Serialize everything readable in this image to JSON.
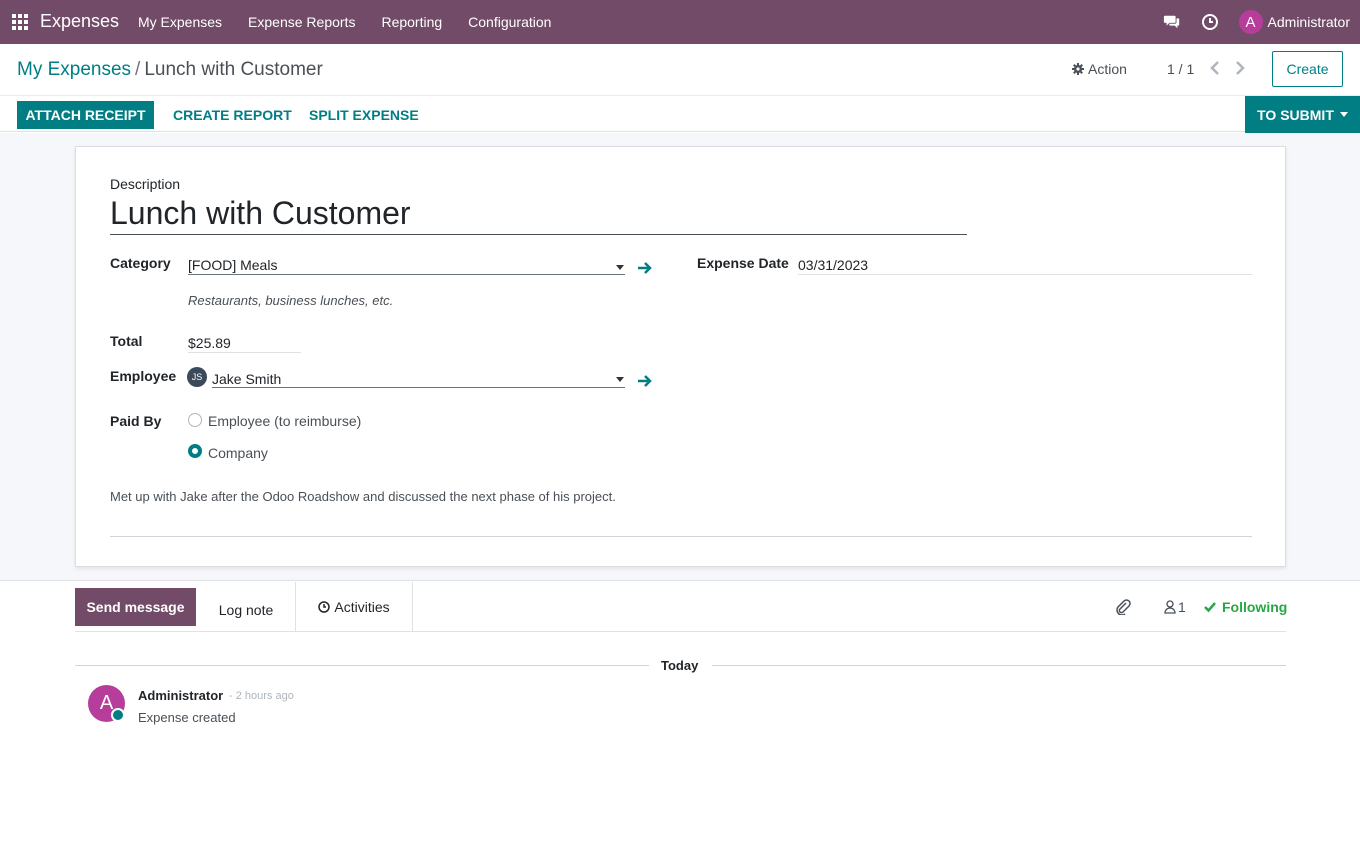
{
  "navbar": {
    "brand": "Expenses",
    "menu": [
      "My Expenses",
      "Expense Reports",
      "Reporting",
      "Configuration"
    ],
    "user_initial": "A",
    "user_name": "Administrator",
    "bg_color": "#714B67"
  },
  "breadcrumb": {
    "parent": "My Expenses",
    "separator": "/",
    "current": "Lunch with Customer"
  },
  "control": {
    "action_label": "Action",
    "pager": "1 / 1",
    "create_label": "Create"
  },
  "buttons": {
    "attach_receipt": "ATTACH RECEIPT",
    "create_report": "CREATE REPORT",
    "split_expense": "SPLIT EXPENSE",
    "status": "TO SUBMIT"
  },
  "form": {
    "description_label": "Description",
    "description": "Lunch with Customer",
    "category_label": "Category",
    "category": "[FOOD] Meals",
    "category_help": "Restaurants, business lunches, etc.",
    "expense_date_label": "Expense Date",
    "expense_date": "03/31/2023",
    "total_label": "Total",
    "total": "$25.89",
    "employee_label": "Employee",
    "employee_initials": "JS",
    "employee": "Jake Smith",
    "paid_by_label": "Paid By",
    "paid_by_options": [
      "Employee (to reimburse)",
      "Company"
    ],
    "paid_by_selected": "Company",
    "notes": "Met up with Jake after the Odoo Roadshow and discussed the next phase of his project."
  },
  "chatter": {
    "send_message": "Send message",
    "log_note": "Log note",
    "activities": "Activities",
    "followers_count": "1",
    "following": "Following",
    "date_separator": "Today",
    "message": {
      "author_initial": "A",
      "author": "Administrator",
      "time": "- 2 hours ago",
      "body": "Expense created"
    }
  },
  "colors": {
    "primary": "#017e84",
    "brand": "#714B67",
    "following": "#28a745"
  }
}
